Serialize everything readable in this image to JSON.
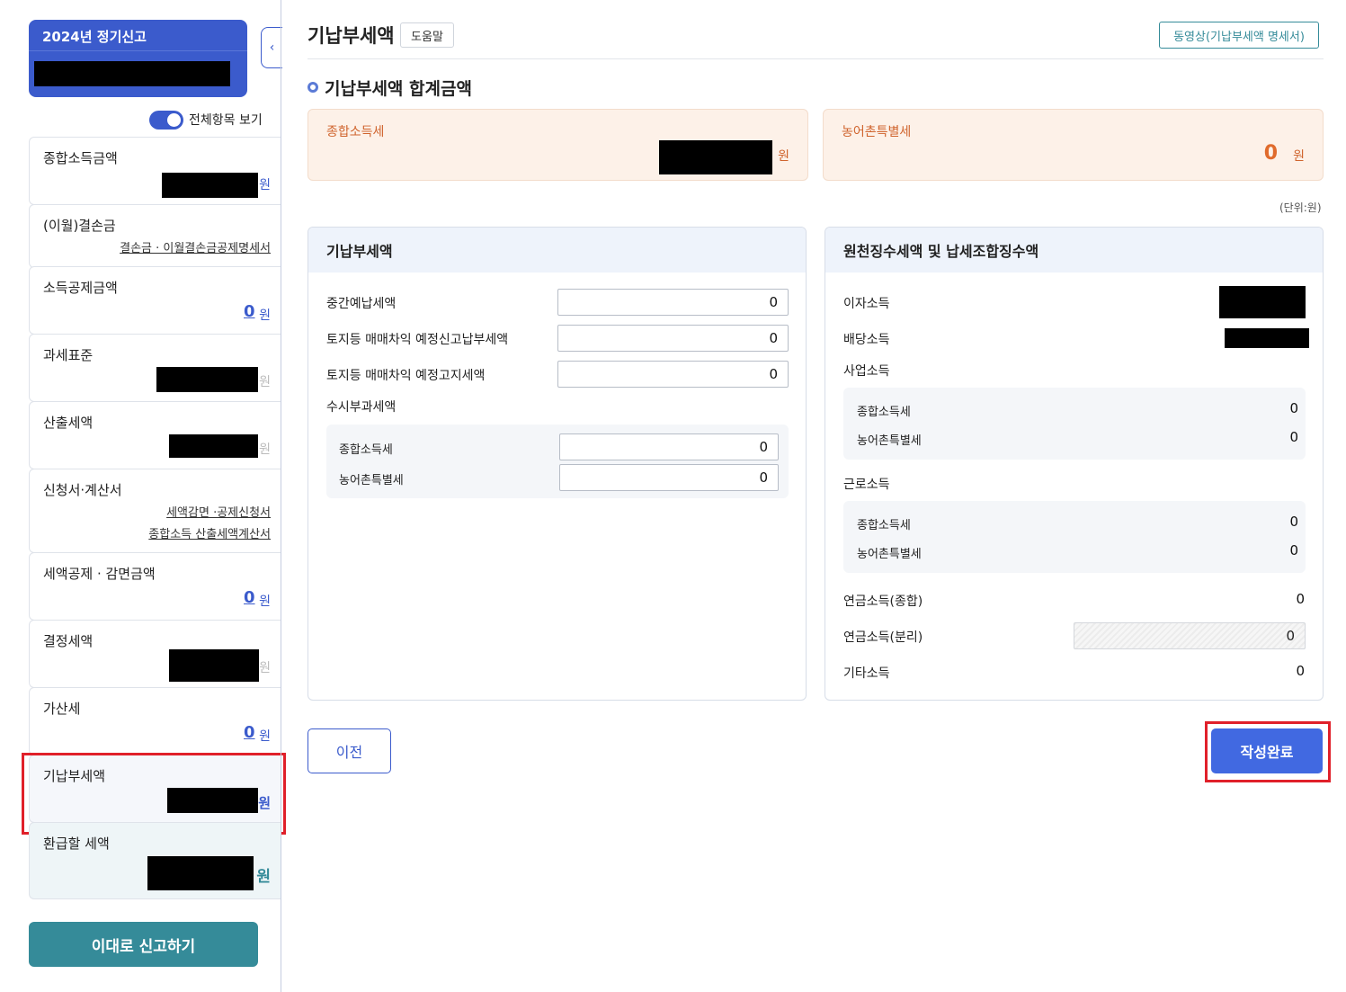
{
  "sidebar": {
    "header_title": "2024년 정기신고",
    "toggle_label": "전체항목 보기",
    "collapse_icon": "‹",
    "items": [
      {
        "label": "종합소득금액",
        "unit": "원"
      },
      {
        "label": "(이월)결손금",
        "link": "결손금 · 이월결손금공제명세서"
      },
      {
        "label": "소득공제금액",
        "value": "0",
        "unit": "원"
      },
      {
        "label": "과세표준",
        "unit": "원"
      },
      {
        "label": "산출세액",
        "unit": "원"
      },
      {
        "label": "신청서·계산서",
        "links": [
          "세액감면 ·공제신청서",
          "종합소득 산출세액계산서"
        ]
      },
      {
        "label": "세액공제 · 감면금액",
        "value": "0",
        "unit": "원"
      },
      {
        "label": "결정세액",
        "unit": "원"
      },
      {
        "label": "가산세",
        "value": "0",
        "unit": "원"
      },
      {
        "label": "기납부세액",
        "unit": "원"
      },
      {
        "label": "환급할 세액",
        "unit": "원"
      }
    ],
    "report_button": "이대로 신고하기"
  },
  "header": {
    "title": "기납부세액",
    "help_button": "도움말",
    "video_button": "동영상(기납부세액 명세서)"
  },
  "summary": {
    "section_title": "기납부세액 합계금액",
    "income_tax_label": "종합소득세",
    "income_tax_unit": "원",
    "rural_tax_label": "농어촌특별세",
    "rural_tax_value": "0",
    "rural_tax_unit": "원",
    "unit_note": "(단위:원)"
  },
  "prepaid": {
    "title": "기납부세액",
    "rows": [
      {
        "label": "중간예납세액",
        "value": "0"
      },
      {
        "label": "토지등 매매차익 예정신고납부세액",
        "value": "0"
      },
      {
        "label": "토지등 매매차익 예정고지세액",
        "value": "0"
      }
    ],
    "occasional_label": "수시부과세액",
    "occasional_rows": [
      {
        "label": "종합소득세",
        "value": "0"
      },
      {
        "label": "농어촌특별세",
        "value": "0"
      }
    ]
  },
  "withholding": {
    "title": "원천징수세액 및 납세조합징수액",
    "interest": "이자소득",
    "dividend": "배당소득",
    "business": {
      "label": "사업소득",
      "rows": [
        {
          "label": "종합소득세",
          "value": "0"
        },
        {
          "label": "농어촌특별세",
          "value": "0"
        }
      ]
    },
    "earned": {
      "label": "근로소득",
      "rows": [
        {
          "label": "종합소득세",
          "value": "0"
        },
        {
          "label": "농어촌특별세",
          "value": "0"
        }
      ]
    },
    "pension_combined": {
      "label": "연금소득(종합)",
      "value": "0"
    },
    "pension_separate": {
      "label": "연금소득(분리)",
      "value": "0"
    },
    "other": {
      "label": "기타소득",
      "value": "0"
    }
  },
  "footer": {
    "prev_button": "이전",
    "done_button": "작성완료"
  },
  "colors": {
    "brand_blue": "#3b5bcc",
    "teal": "#358b99",
    "highlight_red": "#e0202a",
    "orange": "#d0642d"
  }
}
